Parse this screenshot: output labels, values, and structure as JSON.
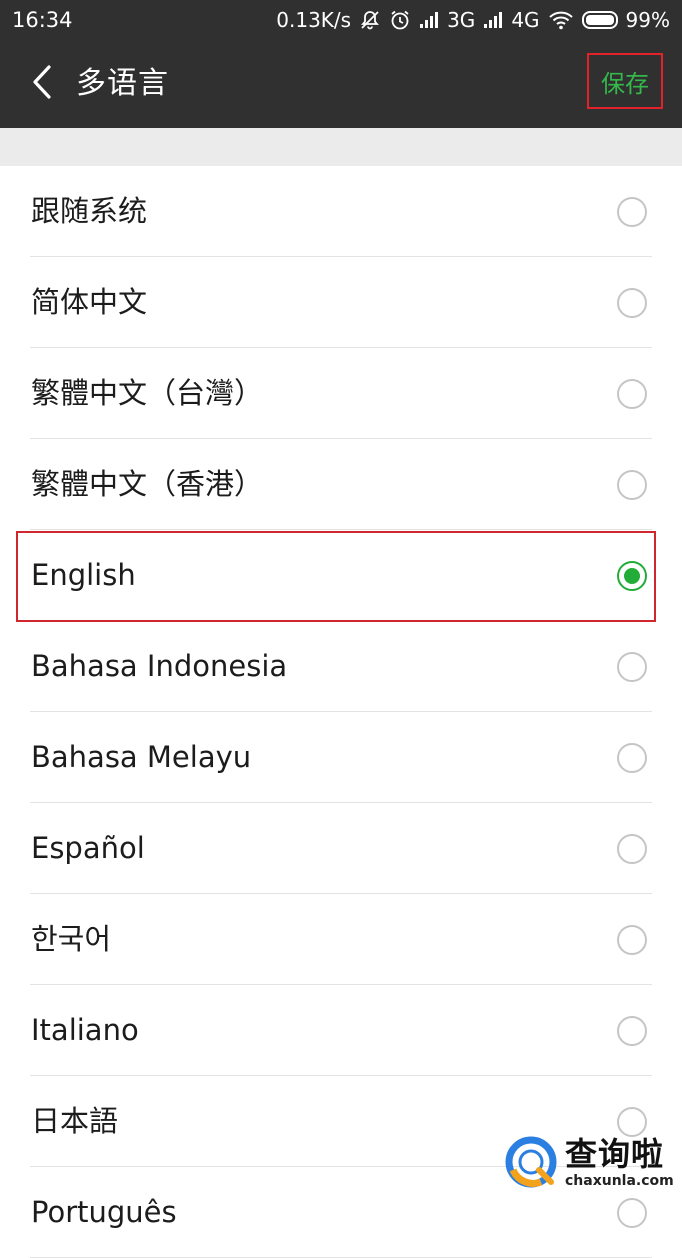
{
  "status_bar": {
    "time": "16:34",
    "net_speed": "0.13K/s",
    "net_3g": "3G",
    "net_4g": "4G",
    "battery": "99%",
    "icons": [
      "mute-bell-icon",
      "alarm-icon",
      "signal-icon",
      "signal-icon",
      "wifi-icon",
      "battery-icon"
    ]
  },
  "header": {
    "back_icon": "chevron-left-icon",
    "title": "多语言",
    "save_label": "保存",
    "save_color": "#35b84a"
  },
  "languages": [
    {
      "label": "跟随系统",
      "selected": false
    },
    {
      "label": "简体中文",
      "selected": false
    },
    {
      "label": "繁體中文（台灣）",
      "selected": false
    },
    {
      "label": "繁體中文（香港）",
      "selected": false
    },
    {
      "label": "English",
      "selected": true
    },
    {
      "label": "Bahasa Indonesia",
      "selected": false
    },
    {
      "label": "Bahasa Melayu",
      "selected": false
    },
    {
      "label": "Español",
      "selected": false
    },
    {
      "label": "한국어",
      "selected": false
    },
    {
      "label": "Italiano",
      "selected": false
    },
    {
      "label": "日本語",
      "selected": false
    },
    {
      "label": "Português",
      "selected": false
    }
  ],
  "accent_color": "#22ac38",
  "annotation_color": "#d0262e",
  "watermark": {
    "cn": "查询啦",
    "en": "chaxunla.com"
  }
}
